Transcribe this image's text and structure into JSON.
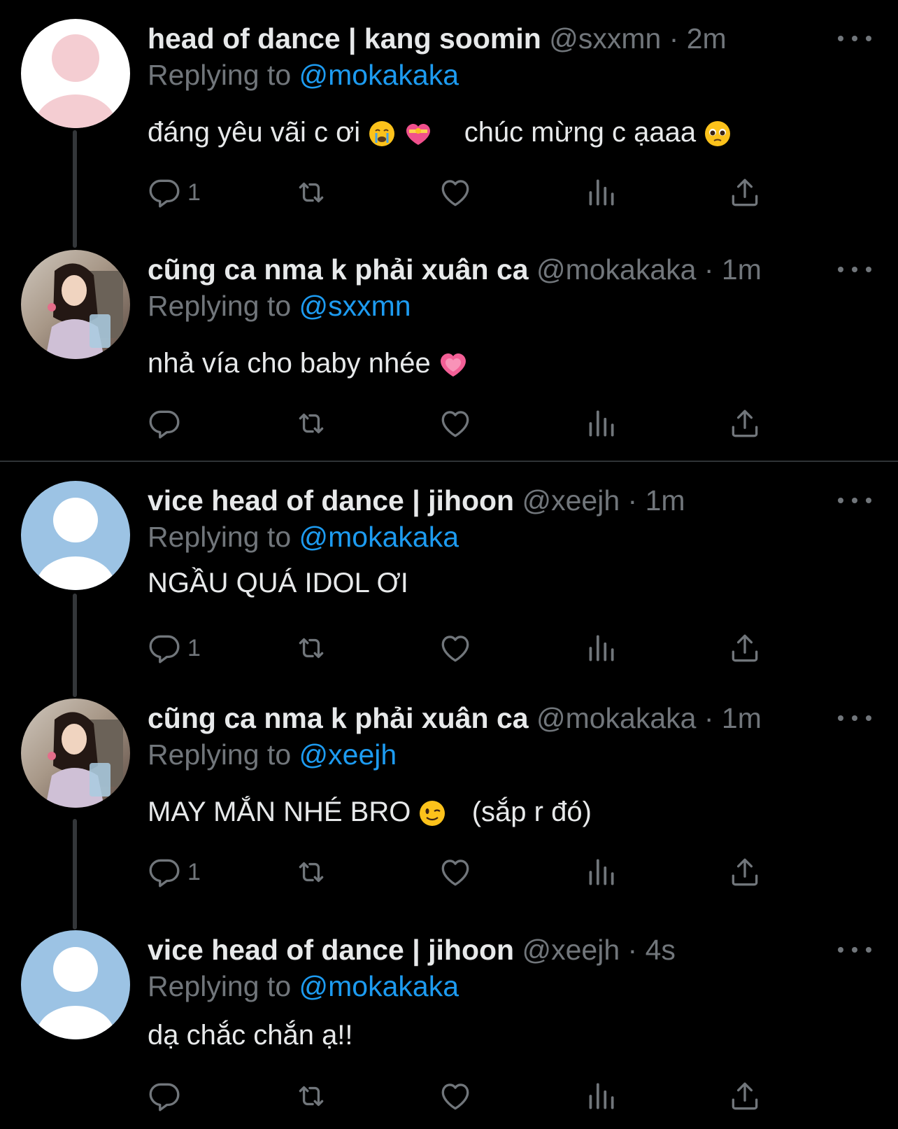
{
  "tweets": [
    {
      "name": "head of dance | kang soomin",
      "handle": "@sxxmn",
      "time": "2m",
      "replying": "Replying to",
      "mention": "@mokakaka",
      "text_a": "đáng yêu vãi c ơi",
      "text_b": "chúc mừng c ạaaa",
      "reply_count": "1",
      "avatar_icon": "default-avatar-pink-icon"
    },
    {
      "name": "cũng ca nma k phải xuân ca",
      "handle": "@mokakaka",
      "time": "1m",
      "replying": "Replying to",
      "mention": "@sxxmn",
      "text_a": "nhả vía cho baby nhée",
      "reply_count": "",
      "avatar_icon": "profile-photo"
    },
    {
      "name": "vice head of dance | jihoon",
      "handle": "@xeejh",
      "time": "1m",
      "replying": "Replying to",
      "mention": "@mokakaka",
      "text_a": "NGẦU QUÁ IDOL ƠI",
      "reply_count": "1",
      "avatar_icon": "default-avatar-blue-icon"
    },
    {
      "name": "cũng ca nma k phải xuân ca",
      "handle": "@mokakaka",
      "time": "1m",
      "replying": "Replying to",
      "mention": "@xeejh",
      "text_a": "MAY MẮN NHÉ BRO",
      "text_b": "(sắp r đó)",
      "reply_count": "1",
      "avatar_icon": "profile-photo"
    },
    {
      "name": "vice head of dance | jihoon",
      "handle": "@xeejh",
      "time": "4s",
      "replying": "Replying to",
      "mention": "@mokakaka",
      "text_a": "dạ chắc chắn ạ!!",
      "reply_count": "",
      "avatar_icon": "default-avatar-blue-icon"
    }
  ],
  "colors": {
    "background": "#000000",
    "text": "#e7e9ea",
    "muted": "#71767b",
    "link": "#1d9bf0"
  },
  "icons": [
    "reply-icon",
    "retweet-icon",
    "like-icon",
    "views-icon",
    "share-icon",
    "more-icon"
  ]
}
